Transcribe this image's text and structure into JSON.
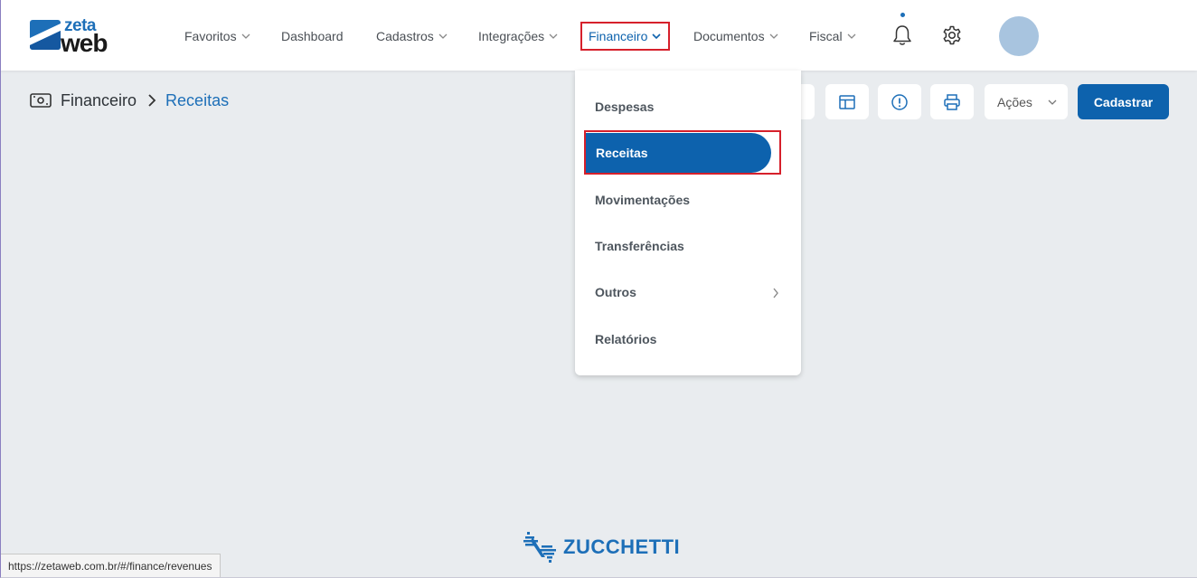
{
  "brand": {
    "logo_top": "zeta",
    "logo_bottom": "web",
    "color": "#1d6fb8"
  },
  "nav": {
    "items": [
      {
        "label": "Favoritos",
        "dropdown": true
      },
      {
        "label": "Dashboard",
        "dropdown": false
      },
      {
        "label": "Cadastros",
        "dropdown": true
      },
      {
        "label": "Integrações",
        "dropdown": true
      },
      {
        "label": "Financeiro",
        "dropdown": true,
        "active": true
      },
      {
        "label": "Documentos",
        "dropdown": true
      },
      {
        "label": "Fiscal",
        "dropdown": true
      }
    ],
    "icons": [
      "bell-icon",
      "gear-icon",
      "avatar"
    ]
  },
  "breadcrumb": {
    "root": "Financeiro",
    "current": "Receitas",
    "icon": "money-icon"
  },
  "toolbar": {
    "buttons": [
      "layout-icon",
      "info-icon",
      "print-icon"
    ],
    "actions_label": "Ações",
    "primary_label": "Cadastrar",
    "primary_color": "#0d62ad"
  },
  "menu": {
    "items": [
      {
        "label": "Despesas"
      },
      {
        "label": "Receitas",
        "selected": true
      },
      {
        "label": "Movimentações"
      },
      {
        "label": "Transferências"
      },
      {
        "label": "Outros",
        "submenu": true
      },
      {
        "label": "Relatórios"
      }
    ]
  },
  "footer": {
    "brand": "ZUCCHETTI"
  },
  "status": {
    "url": "https://zetaweb.com.br/#/finance/revenues"
  }
}
